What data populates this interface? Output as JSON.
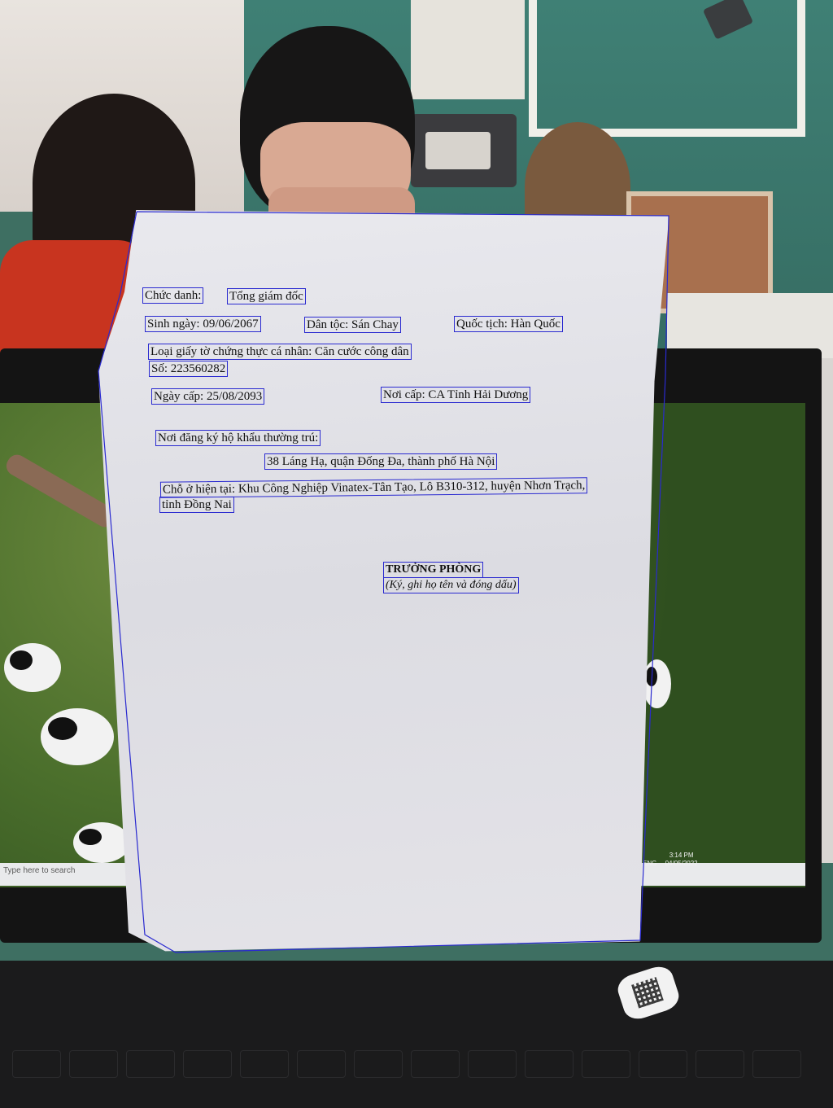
{
  "document": {
    "chuc_danh_label": "Chức danh:",
    "chuc_danh_value": "Tổng giám đốc",
    "sinh_ngay": "Sinh ngày: 09/06/2067",
    "dan_toc": "Dân tộc: Sán Chay",
    "quoc_tich": "Quốc tịch: Hàn Quốc",
    "loai_giay_to": "Loại giấy tờ chứng thực cá nhân: Căn cước công dân",
    "so": "Số: 223560282",
    "ngay_cap": "Ngày cấp: 25/08/2093",
    "noi_cap": "Nơi cấp: CA Tỉnh Hải Dương",
    "noi_dang_ky_label": "Nơi đăng ký hộ khẩu thường trú:",
    "noi_dang_ky_value": "38 Láng Hạ, quận Đống Đa, thành phố Hà Nội",
    "cho_o_line1": "Chỗ ở hiện tại: Khu Công Nghiệp Vinatex-Tân Tạo, Lô B310-312, huyện Nhơn Trạch,",
    "cho_o_line2": "tỉnh Đồng Nai",
    "signature_title": "TRƯỞNG PHÒNG",
    "signature_note": "(Ký, ghi họ tên và đóng dấu)"
  },
  "laptop": {
    "taskbar_search_placeholder": "Type here to search",
    "tray_language": "ENG",
    "tray_time": "3:14 PM",
    "tray_date": "04/05/2022"
  },
  "colors": {
    "annotation_box": "#2a2ad0",
    "paper": "#e4e3e8",
    "wall": "#3f8075"
  }
}
